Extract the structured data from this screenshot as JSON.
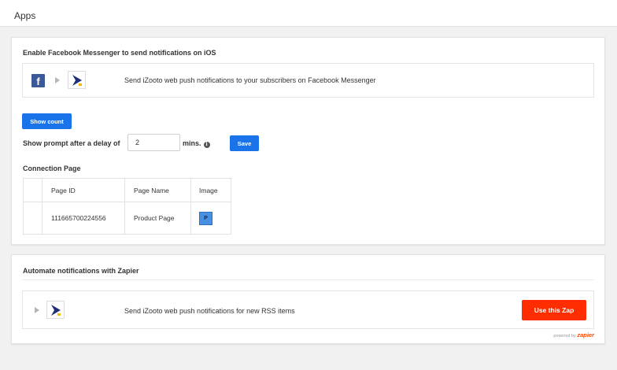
{
  "header": {
    "title": "Apps"
  },
  "messenger_section": {
    "heading": "Enable Facebook Messenger to send notifications on iOS",
    "row_text": "Send iZooto web push notifications to your subscribers on Facebook Messenger",
    "fb_letter": "f",
    "show_count_label": "Show count",
    "delay_label": "Show prompt after a delay of",
    "delay_value": "2",
    "delay_unit": "mins.",
    "info_glyph": "i",
    "save_label": "Save",
    "connection_heading": "Connection Page",
    "table": {
      "columns": [
        "",
        "Page ID",
        "Page Name",
        "Image"
      ],
      "rows": [
        {
          "page_id": "111665700224556",
          "page_name": "Product Page",
          "image_letter": "P"
        }
      ]
    }
  },
  "zapier_section": {
    "heading": "Automate notifications with Zapier",
    "row_text": "Send iZooto web push notifications for new RSS items",
    "use_zap_label": "Use this Zap",
    "powered_by": "powered by",
    "powered_brand": "zapier"
  },
  "colors": {
    "primary_blue": "#1a73e8",
    "zapier_red": "#ff2d00",
    "facebook_blue": "#3b5998",
    "izooto_navy": "#1e2e78",
    "izooto_yellow": "#f6b800"
  },
  "icons": [
    "facebook-icon",
    "caret-right-icon",
    "izooto-icon",
    "info-icon"
  ]
}
